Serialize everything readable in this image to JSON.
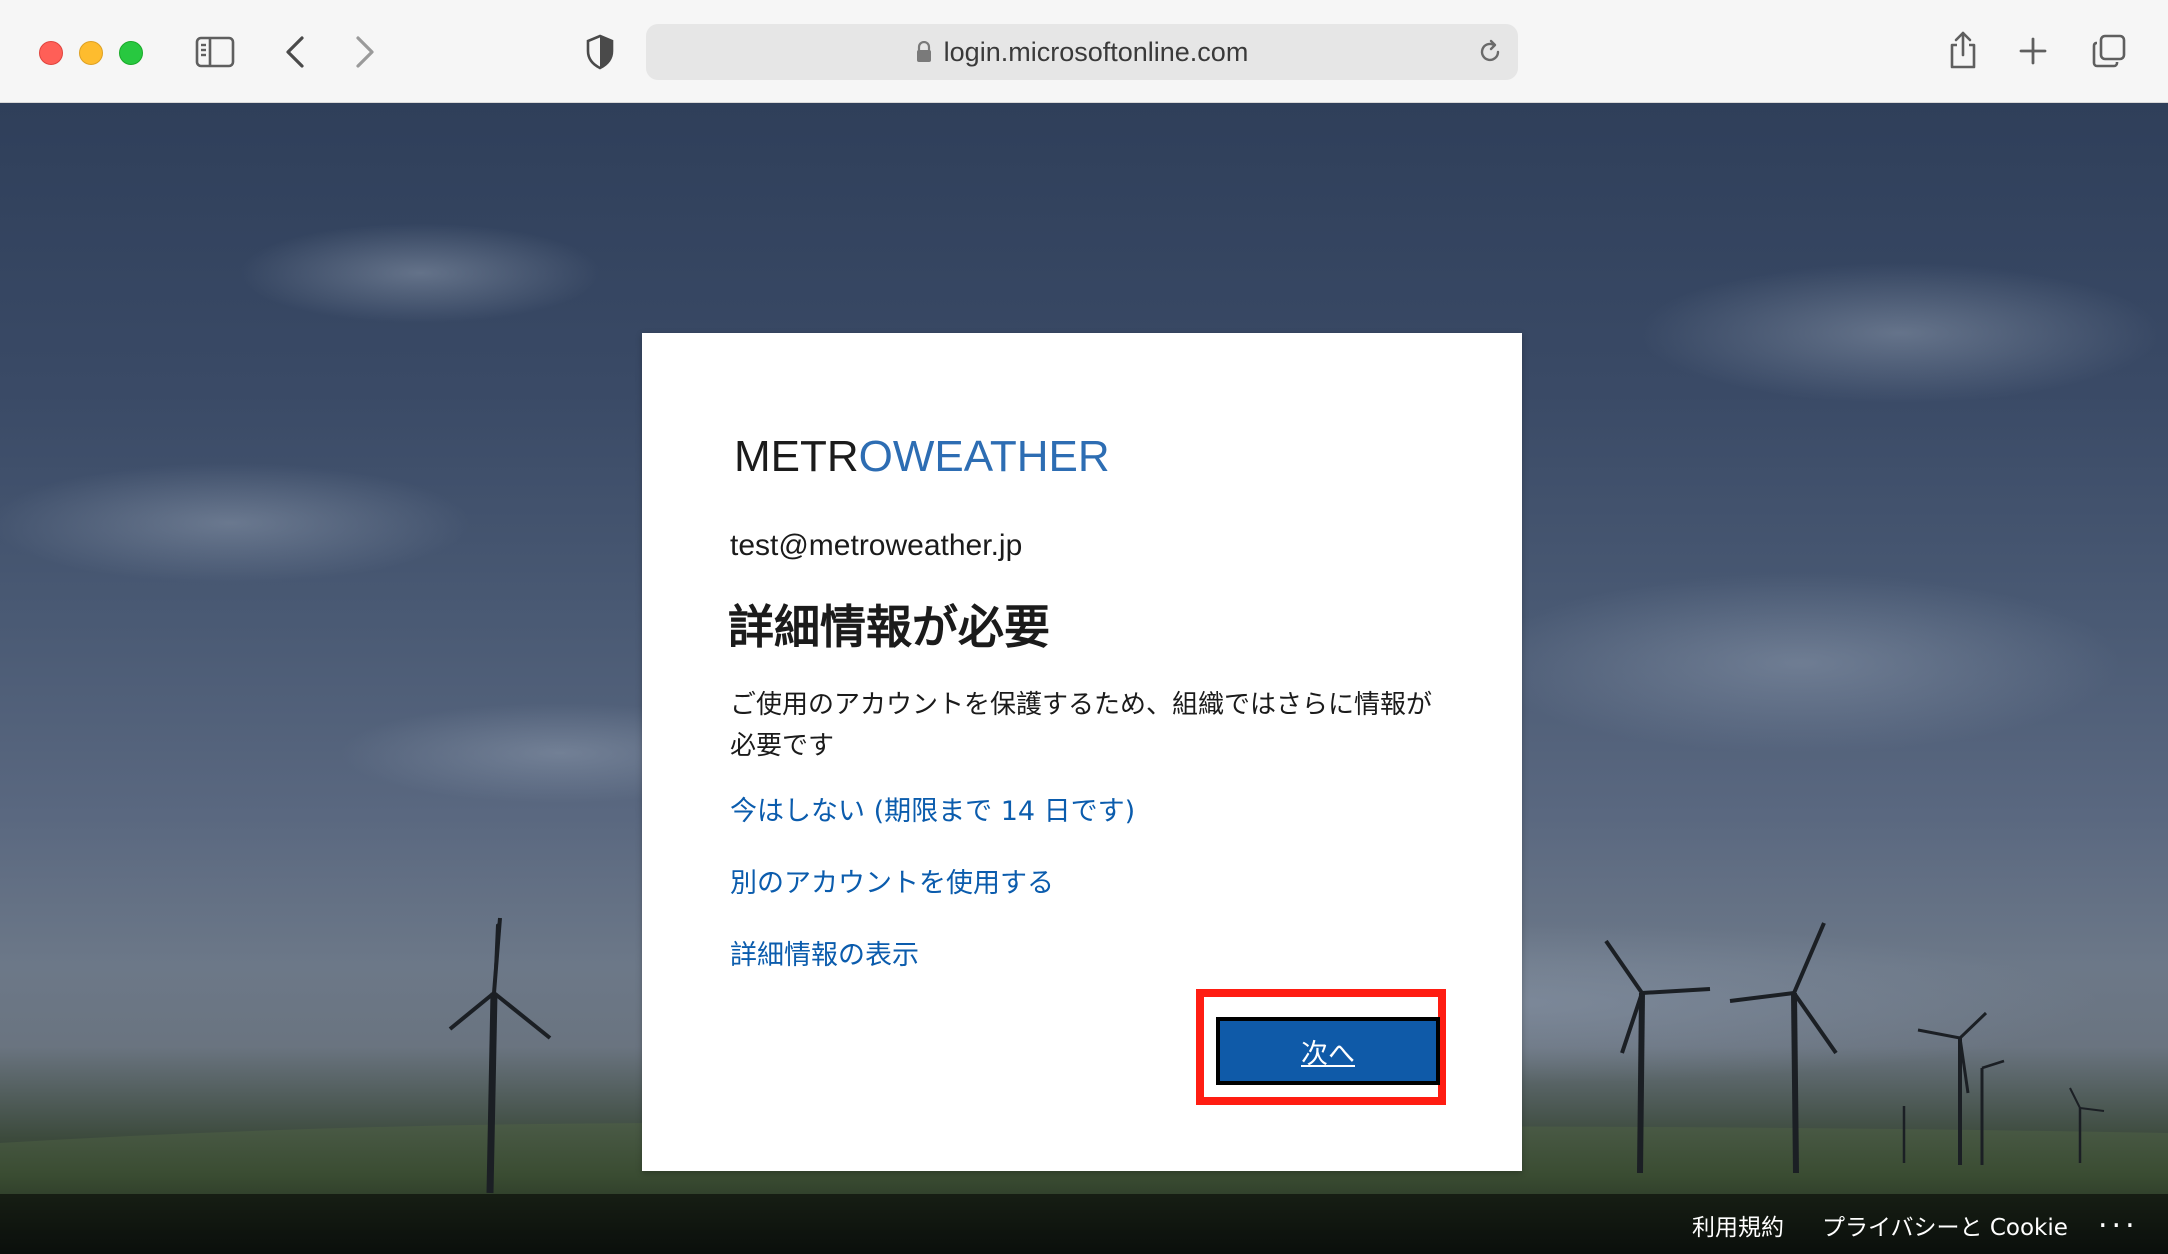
{
  "browser": {
    "url": "login.microsoftonline.com",
    "icons": {
      "sidebar": "sidebar-icon",
      "back": "chevron-left-icon",
      "forward": "chevron-right-icon",
      "privacy": "shield-icon",
      "lock": "lock-icon",
      "reload": "reload-icon",
      "share": "share-icon",
      "new_tab": "plus-icon",
      "tabs": "tabs-overview-icon"
    }
  },
  "card": {
    "logo": {
      "metr": "METR",
      "o": "O",
      "weather": "WEATHER"
    },
    "identity": "test@metroweather.jp",
    "title": "詳細情報が必要",
    "description": "ご使用のアカウントを保護するため、組織ではさらに情報が必要です",
    "links": {
      "skip": "今はしない (期限まで 14 日です)",
      "other_account": "別のアカウントを使用する",
      "more_info": "詳細情報の表示"
    },
    "next_button": "次へ"
  },
  "footer": {
    "terms": "利用規約",
    "privacy": "プライバシーと Cookie",
    "more": "..."
  },
  "colors": {
    "link": "#0b5cad",
    "button": "#0f5aa8",
    "highlight": "#ff1d12",
    "brand_blue": "#2d6db3"
  }
}
